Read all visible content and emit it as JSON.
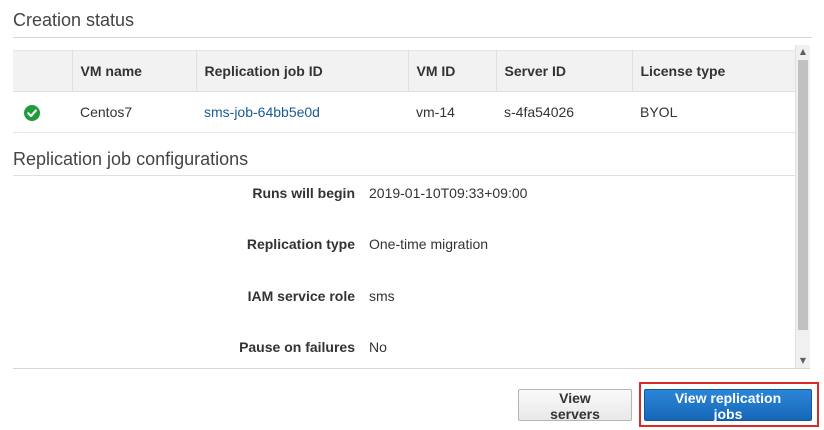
{
  "creation": {
    "title": "Creation status",
    "columns": [
      "",
      "VM name",
      "Replication job ID",
      "VM ID",
      "Server ID",
      "License type"
    ],
    "rows": [
      {
        "status_icon": "check-circle-icon",
        "vm_name": "Centos7",
        "job_id": "sms-job-64bb5e0d",
        "vm_id": "vm-14",
        "server_id": "s-4fa54026",
        "license_type": "BYOL"
      }
    ]
  },
  "config": {
    "title": "Replication job configurations",
    "items": [
      {
        "label": "Runs will begin",
        "value": "2019-01-10T09:33+09:00"
      },
      {
        "label": "Replication type",
        "value": "One-time migration"
      },
      {
        "label": "IAM service role",
        "value": "sms"
      },
      {
        "label": "Pause on failures",
        "value": "No"
      }
    ]
  },
  "actions": {
    "view_servers": "View servers",
    "view_jobs": "View replication jobs"
  },
  "colors": {
    "primary": "#1767b8",
    "link": "#1a5a96",
    "success": "#1d9c3a",
    "highlight": "#d82c2c"
  }
}
